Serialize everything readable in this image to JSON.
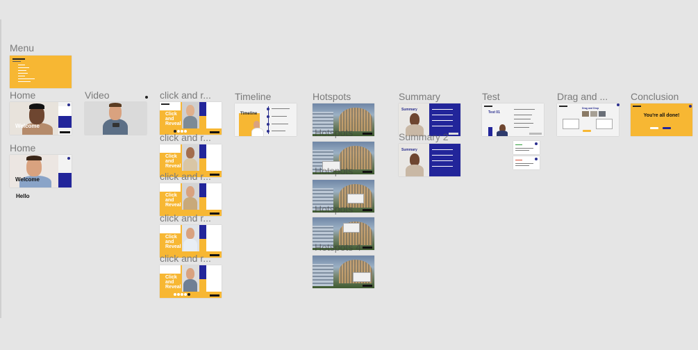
{
  "canvas": {
    "labels": {
      "menu": "Menu",
      "home": "Home",
      "home2": "Home",
      "video": "Video",
      "click1": "click and r...",
      "click2": "click and r...",
      "click3": "click and r...",
      "click4": "click and r...",
      "click5": "click and r...",
      "timeline": "Timeline",
      "hotspots": "Hotspots",
      "hs_over2": "Hotspots",
      "hs_over3": "Hotspots",
      "hs_over4": "Hotspots",
      "hs_over5": "Hotspots 4",
      "summary": "Summary",
      "summary2": "Summary 2",
      "test": "Test",
      "drag": "Drag and ...",
      "conclusion": "Conclusion"
    },
    "slides": {
      "home_welcome": "Welcome",
      "home2_welcome": "Welcome",
      "home2_hello": "Hello",
      "click_title1": "Click",
      "click_title2": "and",
      "click_title3": "Reveal",
      "timeline_title": "Timeline",
      "summary_title": "Summary",
      "test_title": "Test 01",
      "drag_title": "Drag and Drop",
      "conclusion_text": "You're all done!"
    },
    "colors": {
      "yellow": "#f7b733",
      "navy": "#22259a",
      "canvas": "#e5e5e5"
    }
  }
}
